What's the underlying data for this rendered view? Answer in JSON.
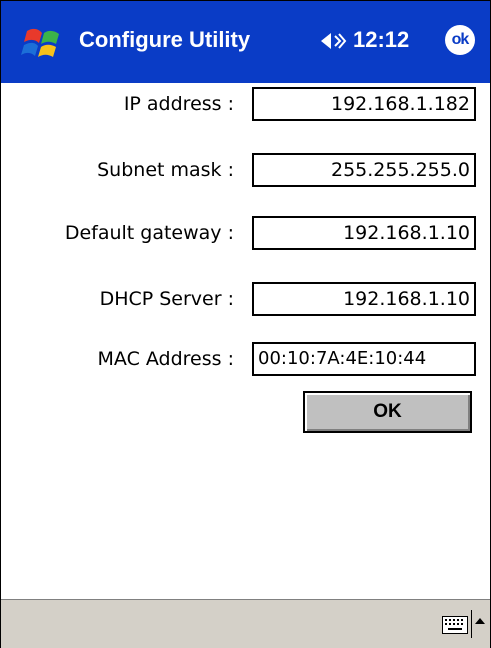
{
  "titlebar": {
    "title": "Configure Utility",
    "clock": "12:12",
    "ok_label": "ok",
    "bg_color": "#0a3cc6",
    "icons": [
      "windows-flag-icon",
      "speaker-icon"
    ]
  },
  "form": {
    "ip": {
      "label": "IP address :",
      "value": "192.168.1.182"
    },
    "subnet": {
      "label": "Subnet mask :",
      "value": "255.255.255.0"
    },
    "gateway": {
      "label": "Default gateway :",
      "value": "192.168.1.10"
    },
    "dhcp": {
      "label": "DHCP Server :",
      "value": "192.168.1.10"
    },
    "mac": {
      "label": "MAC Address :",
      "value": "00:10:7A:4E:10:44"
    }
  },
  "ok_button": {
    "label": "OK"
  },
  "bottombar": {
    "icons": [
      "keyboard-icon",
      "sip-arrow-icon"
    ],
    "bg_color": "#d4d0c8"
  }
}
